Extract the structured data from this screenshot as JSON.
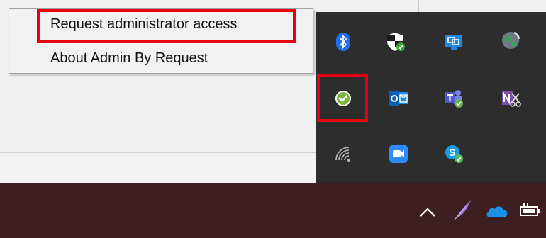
{
  "context_menu": {
    "items": [
      {
        "label": "Request administrator access"
      },
      {
        "label": "About Admin By Request"
      }
    ]
  },
  "tray_icons": [
    "bluetooth-icon",
    "windows-security-icon",
    "display-icon",
    "globe-sync-icon",
    "admin-by-request-check-icon",
    "outlook-icon",
    "teams-icon",
    "onenote-clipper-icon",
    "network-icon",
    "zoom-icon",
    "skype-icon"
  ],
  "taskbar_icons": [
    "chevron-up-icon",
    "feather-icon",
    "onedrive-icon",
    "battery-icon"
  ],
  "colors": {
    "highlight": "#e60012",
    "taskbar": "#3e1f21",
    "tray_flyout": "#2d2d2d",
    "menu_bg": "#f2f2f2"
  }
}
